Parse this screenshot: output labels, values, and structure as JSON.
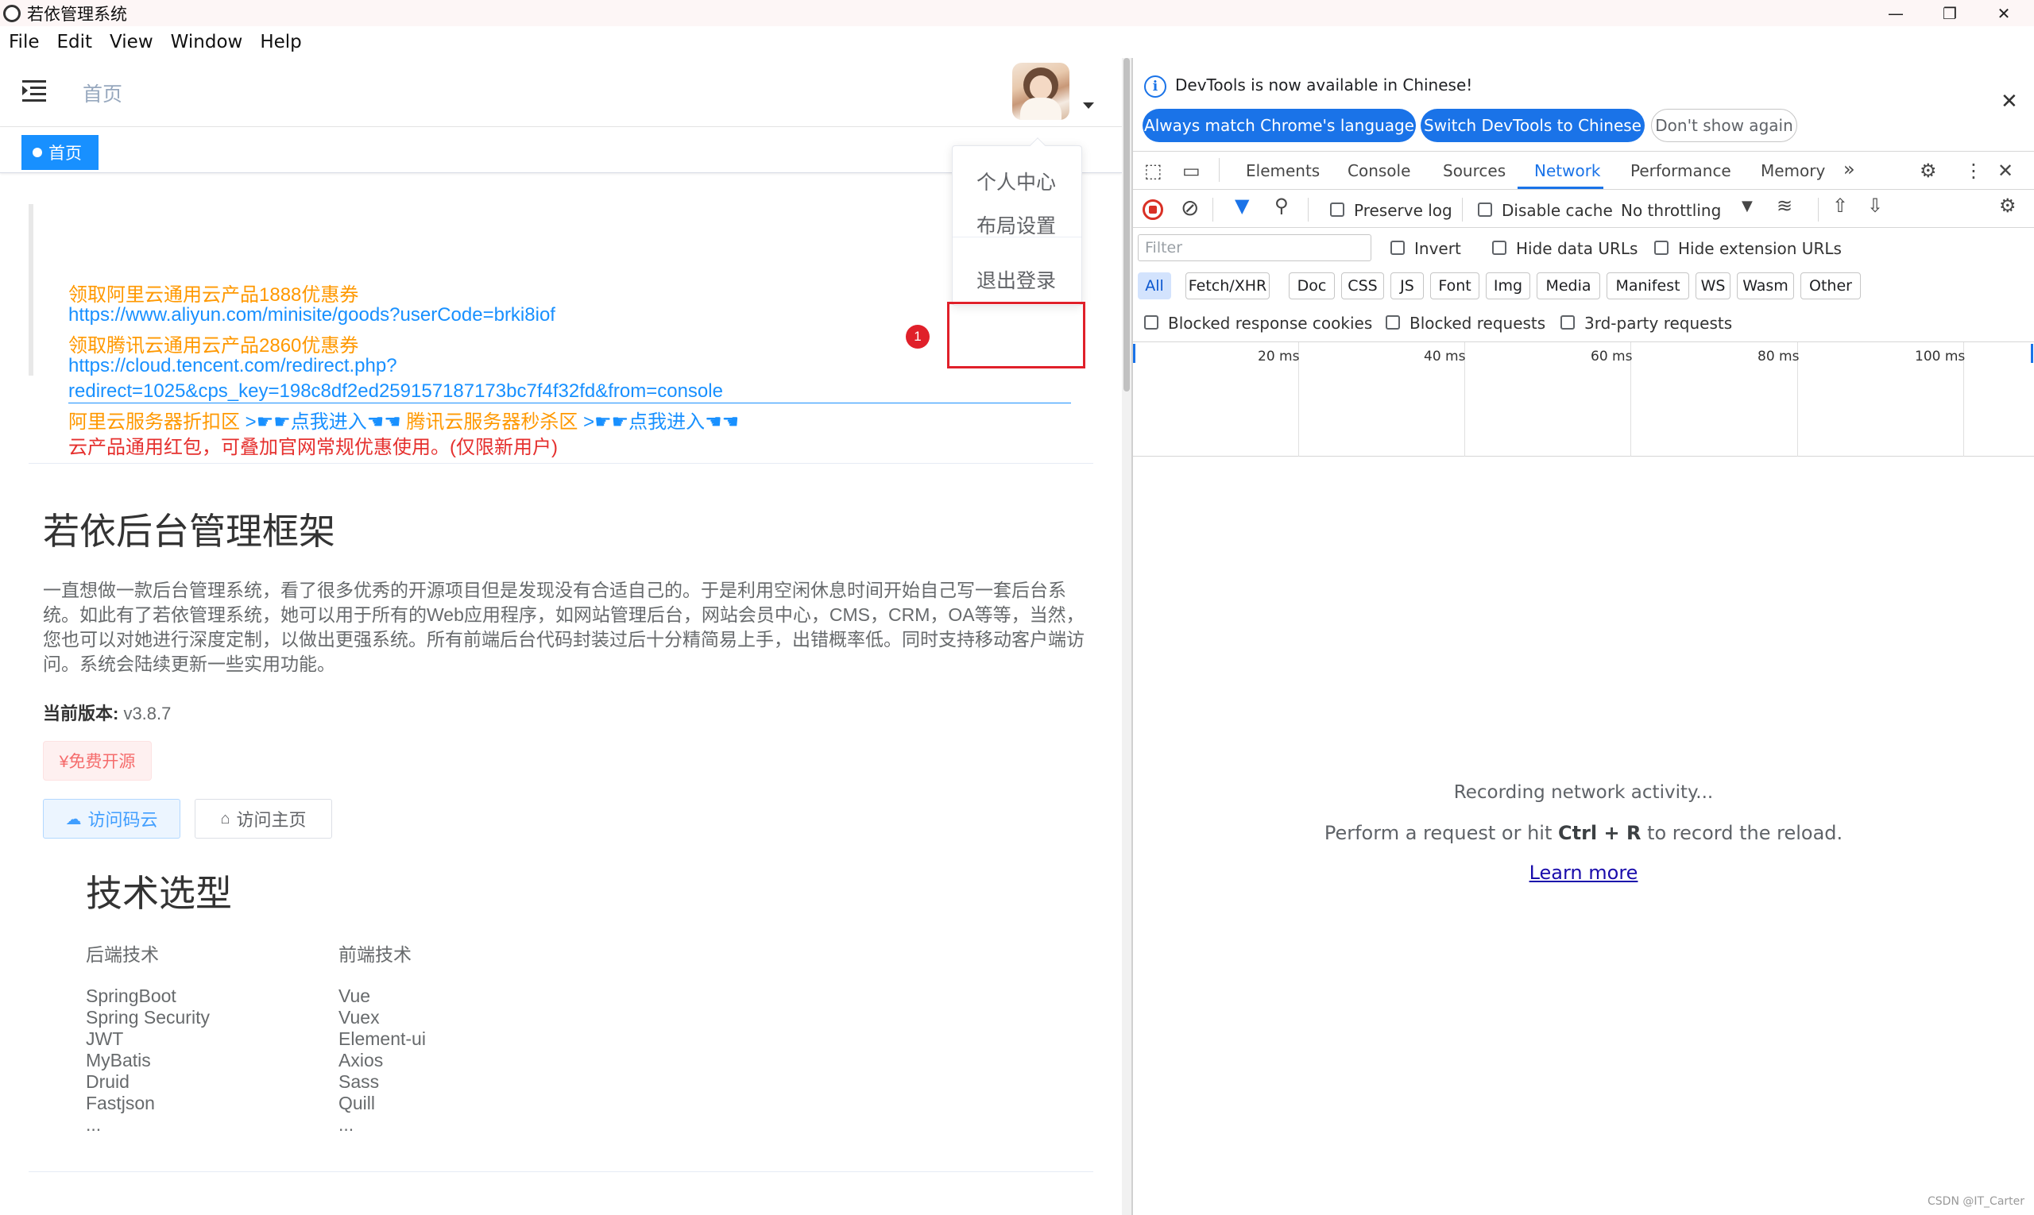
{
  "window": {
    "title": "若依管理系统",
    "controls": [
      "—",
      "❐",
      "✕"
    ]
  },
  "menu": [
    "File",
    "Edit",
    "View",
    "Window",
    "Help"
  ],
  "page": {
    "breadcrumb": "首页",
    "active_tag": "首页",
    "dropdown": {
      "items": [
        "个人中心",
        "布局设置",
        "退出登录"
      ],
      "badge": "1"
    },
    "notice": {
      "line1": "领取阿里云通用云产品1888优惠券",
      "line2": "https://www.aliyun.com/minisite/goods?userCode=brki8iof",
      "line3": "领取腾讯云通用云产品2860优惠券",
      "line4": "https://cloud.tencent.com/redirect.php?",
      "line5": "redirect=1025&cps_key=198c8df2ed259157187173bc7f4f32fd&from=console",
      "line6a": "阿里云服务器折扣区",
      "line6b": ">☛☛点我进入☚☚",
      "line6c": "腾讯云服务器秒杀区",
      "line6d": ">☛☛点我进入☚☚",
      "line7": "云产品通用红包，可叠加官网常规优惠使用。(仅限新用户)"
    },
    "title": "若依后台管理框架",
    "intro": "一直想做一款后台管理系统，看了很多优秀的开源项目但是发现没有合适自己的。于是利用空闲休息时间开始自己写一套后台系统。如此有了若依管理系统，她可以用于所有的Web应用程序，如网站管理后台，网站会员中心，CMS，CRM，OA等等，当然，您也可以对她进行深度定制，以做出更强系统。所有前端后台代码封装过后十分精简易上手，出错概率低。同时支持移动客户端访问。系统会陆续更新一些实用功能。",
    "version_label": "当前版本:",
    "version_value": " v3.8.7",
    "free_tag": "¥免费开源",
    "btn_gitee": "访问码云",
    "btn_home": "访问主页",
    "tech_title": "技术选型",
    "backend_head": "后端技术",
    "frontend_head": "前端技术",
    "backend": [
      "SpringBoot",
      "Spring Security",
      "JWT",
      "MyBatis",
      "Druid",
      "Fastjson",
      "..."
    ],
    "frontend": [
      "Vue",
      "Vuex",
      "Element-ui",
      "Axios",
      "Sass",
      "Quill",
      "..."
    ]
  },
  "devtools": {
    "info_text": "DevTools is now available in Chinese!",
    "btn_match": "Always match Chrome's language",
    "btn_switch": "Switch DevTools to Chinese",
    "btn_dont": "Don't show again",
    "tabs": [
      "Elements",
      "Console",
      "Sources",
      "Network",
      "Performance",
      "Memory"
    ],
    "active_tab": "Network",
    "preserve_log": "Preserve log",
    "disable_cache": "Disable cache",
    "throttling": "No throttling",
    "filter_placeholder": "Filter",
    "invert": "Invert",
    "hide_data_urls": "Hide data URLs",
    "hide_ext_urls": "Hide extension URLs",
    "types": [
      "All",
      "Fetch/XHR",
      "Doc",
      "CSS",
      "JS",
      "Font",
      "Img",
      "Media",
      "Manifest",
      "WS",
      "Wasm",
      "Other"
    ],
    "blocked_cookies": "Blocked response cookies",
    "blocked_requests": "Blocked requests",
    "third_party": "3rd-party requests",
    "timeline_ticks": [
      "20 ms",
      "40 ms",
      "60 ms",
      "80 ms",
      "100 ms"
    ],
    "recording": "Recording network activity...",
    "hint_pre": "Perform a request or hit ",
    "hint_key": "Ctrl + R",
    "hint_post": " to record the reload.",
    "learn_more": "Learn more"
  },
  "watermark": "CSDN @IT_Carter"
}
